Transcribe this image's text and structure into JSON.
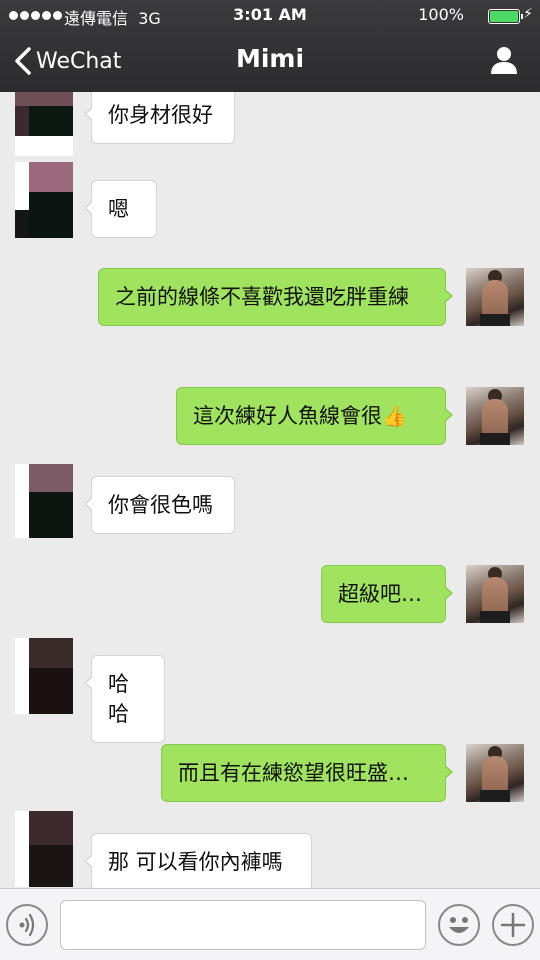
{
  "status_bar": {
    "carrier": "遠傳電信",
    "network": "3G",
    "time": "3:01 AM",
    "battery": "100%",
    "battery_level": 1.0
  },
  "nav": {
    "back_label": "WeChat",
    "title": "Mimi",
    "profile_icon": "person-icon"
  },
  "messages": [
    {
      "dir": "in",
      "text": "你身材很好"
    },
    {
      "dir": "in",
      "text": "嗯"
    },
    {
      "dir": "out",
      "text": "之前的線條不喜歡我還吃胖重練"
    },
    {
      "dir": "out",
      "text": "這次練好人魚線會很",
      "emoji": "👍"
    },
    {
      "dir": "in",
      "text": "你會很色嗎"
    },
    {
      "dir": "out",
      "text": "超級吧…"
    },
    {
      "dir": "in",
      "text": "哈哈"
    },
    {
      "dir": "out",
      "text": "而且有在練慾望很旺盛…"
    },
    {
      "dir": "in",
      "text": "那 可以看你內褲嗎"
    }
  ],
  "input_bar": {
    "voice_icon": "voice-icon",
    "emoji_icon": "emoji-icon",
    "plus_icon": "plus-icon",
    "text_value": ""
  },
  "colors": {
    "header_bg": "#333335",
    "outgoing_bubble": "#9fe35f",
    "incoming_bubble": "#ffffff",
    "chat_bg": "#ebebeb",
    "battery": "#4cd964"
  }
}
